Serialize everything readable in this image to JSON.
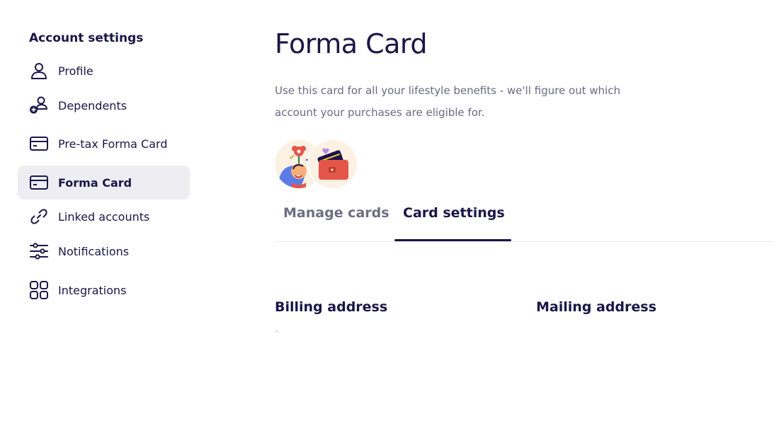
{
  "sidebar": {
    "title": "Account settings",
    "items": [
      {
        "label": "Profile",
        "icon": "person-icon"
      },
      {
        "label": "Dependents",
        "icon": "add-person-icon"
      },
      {
        "label": "Pre-tax Forma Card",
        "icon": "card-icon"
      },
      {
        "label": "Forma Card",
        "icon": "card-icon",
        "active": true
      },
      {
        "label": "Linked accounts",
        "icon": "link-icon"
      },
      {
        "label": "Notifications",
        "icon": "sliders-icon"
      },
      {
        "label": "Integrations",
        "icon": "grid-icon"
      }
    ]
  },
  "main": {
    "title": "Forma Card",
    "description": "Use this card for all your lifestyle benefits - we'll figure out which account your purchases are eligible for.",
    "tabs": [
      {
        "label": "Manage cards",
        "active": false
      },
      {
        "label": "Card settings",
        "active": true
      }
    ],
    "billing_heading": "Billing address",
    "mailing_heading": "Mailing address"
  },
  "colors": {
    "text_primary": "#1b1547",
    "text_secondary": "#6b6a80",
    "active_bg": "#eeeef2",
    "illustration_bg": "#fdf1e4",
    "accent_red": "#e4564a",
    "accent_blue": "#5b7ce8"
  }
}
